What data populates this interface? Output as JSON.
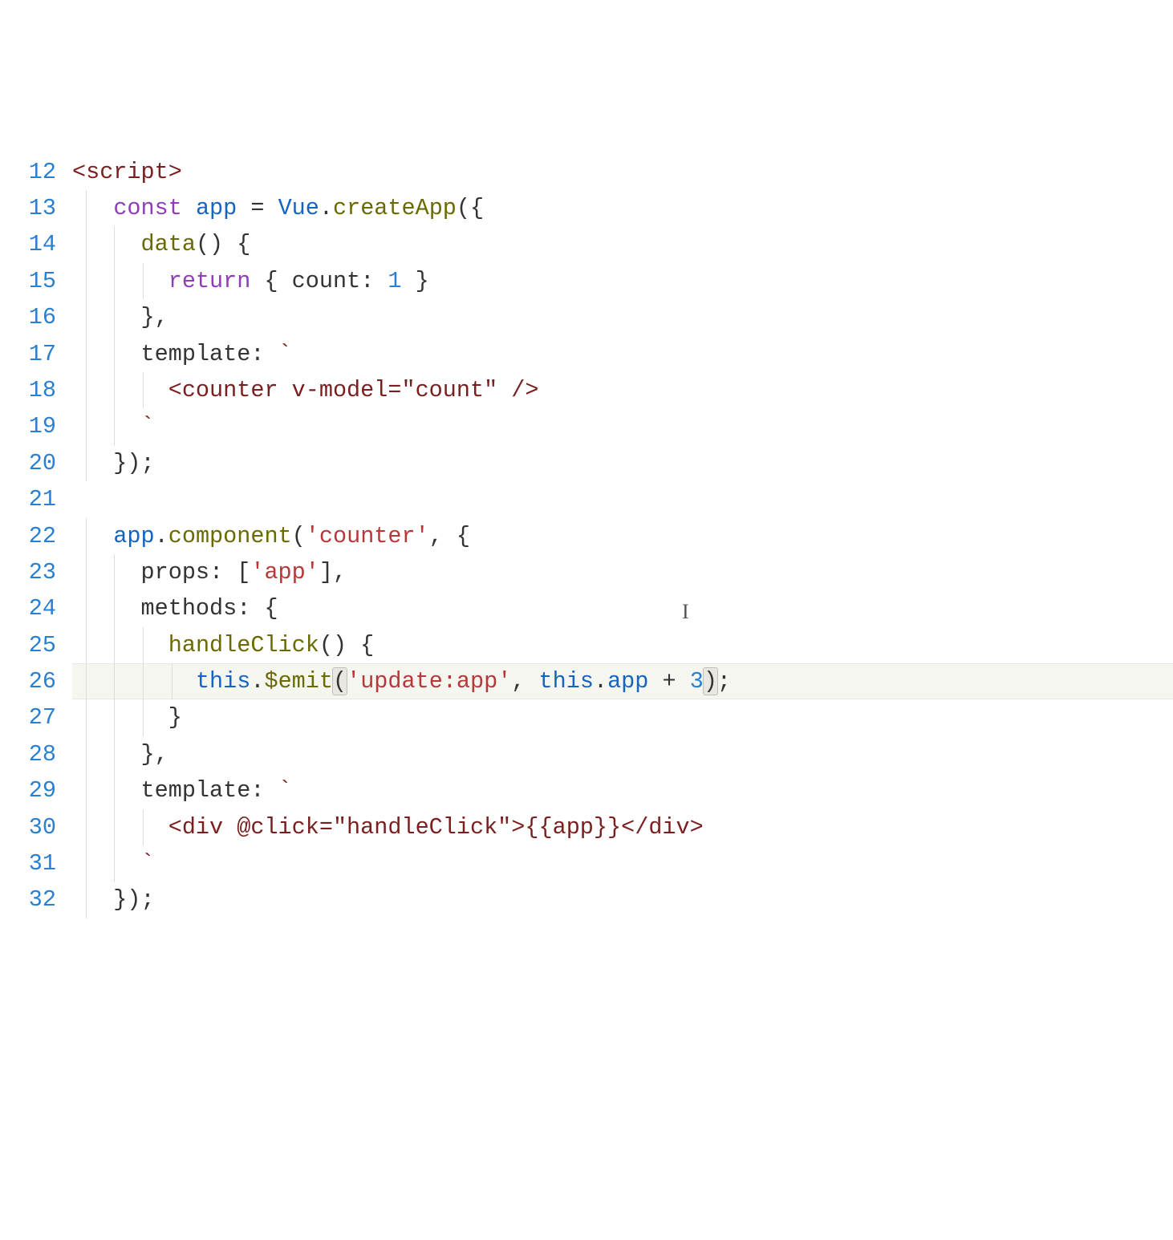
{
  "gutter": {
    "start": 12,
    "end": 32
  },
  "currentLine": 26,
  "cursor": {
    "line": 24,
    "leftPx": 760
  },
  "tokens": {
    "l12": [
      {
        "t": "<script>",
        "c": "c-tag"
      }
    ],
    "l13": [
      {
        "t": "   ",
        "c": "c-default"
      },
      {
        "t": "const",
        "c": "c-kw"
      },
      {
        "t": " ",
        "c": "c-default"
      },
      {
        "t": "app",
        "c": "c-var"
      },
      {
        "t": " = ",
        "c": "c-punct"
      },
      {
        "t": "Vue",
        "c": "c-var"
      },
      {
        "t": ".",
        "c": "c-punct"
      },
      {
        "t": "createApp",
        "c": "c-func"
      },
      {
        "t": "({",
        "c": "c-punct"
      }
    ],
    "l14": [
      {
        "t": "     ",
        "c": "c-default"
      },
      {
        "t": "data",
        "c": "c-func"
      },
      {
        "t": "() {",
        "c": "c-punct"
      }
    ],
    "l15": [
      {
        "t": "       ",
        "c": "c-default"
      },
      {
        "t": "return",
        "c": "c-kw"
      },
      {
        "t": " { ",
        "c": "c-punct"
      },
      {
        "t": "count",
        "c": "c-prop"
      },
      {
        "t": ": ",
        "c": "c-punct"
      },
      {
        "t": "1",
        "c": "c-num"
      },
      {
        "t": " }",
        "c": "c-punct"
      }
    ],
    "l16": [
      {
        "t": "     },",
        "c": "c-punct"
      }
    ],
    "l17": [
      {
        "t": "     ",
        "c": "c-default"
      },
      {
        "t": "template",
        "c": "c-prop"
      },
      {
        "t": ": ",
        "c": "c-punct"
      },
      {
        "t": "`",
        "c": "c-tag"
      }
    ],
    "l18": [
      {
        "t": "       <counter v-model=\"count\" />",
        "c": "c-tag"
      }
    ],
    "l19": [
      {
        "t": "     `",
        "c": "c-tag"
      }
    ],
    "l20": [
      {
        "t": "   });",
        "c": "c-punct"
      }
    ],
    "l21": [
      {
        "t": "",
        "c": "c-default"
      }
    ],
    "l22": [
      {
        "t": "   ",
        "c": "c-default"
      },
      {
        "t": "app",
        "c": "c-var"
      },
      {
        "t": ".",
        "c": "c-punct"
      },
      {
        "t": "component",
        "c": "c-func"
      },
      {
        "t": "(",
        "c": "c-punct"
      },
      {
        "t": "'counter'",
        "c": "c-str"
      },
      {
        "t": ", {",
        "c": "c-punct"
      }
    ],
    "l23": [
      {
        "t": "     ",
        "c": "c-default"
      },
      {
        "t": "props",
        "c": "c-prop"
      },
      {
        "t": ": [",
        "c": "c-punct"
      },
      {
        "t": "'app'",
        "c": "c-str"
      },
      {
        "t": "],",
        "c": "c-punct"
      }
    ],
    "l24": [
      {
        "t": "     ",
        "c": "c-default"
      },
      {
        "t": "methods",
        "c": "c-prop"
      },
      {
        "t": ": {",
        "c": "c-punct"
      }
    ],
    "l25": [
      {
        "t": "       ",
        "c": "c-default"
      },
      {
        "t": "handleClick",
        "c": "c-func"
      },
      {
        "t": "() {",
        "c": "c-punct"
      }
    ],
    "l26": [
      {
        "t": "         ",
        "c": "c-default"
      },
      {
        "t": "this",
        "c": "c-var"
      },
      {
        "t": ".",
        "c": "c-punct"
      },
      {
        "t": "$emit",
        "c": "c-func"
      },
      {
        "t": "(",
        "c": "c-punct",
        "m": true
      },
      {
        "t": "'update:app'",
        "c": "c-str"
      },
      {
        "t": ", ",
        "c": "c-punct"
      },
      {
        "t": "this",
        "c": "c-var"
      },
      {
        "t": ".",
        "c": "c-punct"
      },
      {
        "t": "app",
        "c": "c-var"
      },
      {
        "t": " + ",
        "c": "c-punct"
      },
      {
        "t": "3",
        "c": "c-num"
      },
      {
        "t": ")",
        "c": "c-punct",
        "m": true
      },
      {
        "t": ";",
        "c": "c-punct"
      }
    ],
    "l27": [
      {
        "t": "       }",
        "c": "c-punct"
      }
    ],
    "l28": [
      {
        "t": "     },",
        "c": "c-punct"
      }
    ],
    "l29": [
      {
        "t": "     ",
        "c": "c-default"
      },
      {
        "t": "template",
        "c": "c-prop"
      },
      {
        "t": ": ",
        "c": "c-punct"
      },
      {
        "t": "`",
        "c": "c-tag"
      }
    ],
    "l30": [
      {
        "t": "       <div @click=\"handleClick\">{{app}}</div>",
        "c": "c-tag"
      }
    ],
    "l31": [
      {
        "t": "     `",
        "c": "c-tag"
      }
    ],
    "l32": [
      {
        "t": "   });",
        "c": "c-punct"
      }
    ]
  }
}
